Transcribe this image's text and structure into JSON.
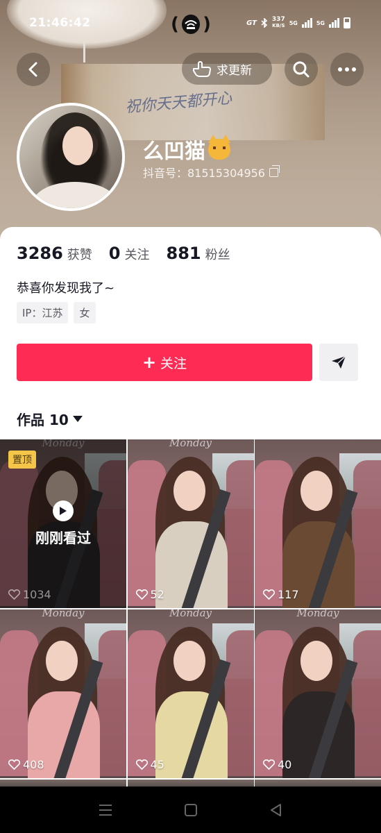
{
  "status_bar": {
    "time": "21:46:42",
    "network_speed_value": "337",
    "network_speed_unit": "KB/S",
    "network_label_1": "5G",
    "network_label_2": "5G",
    "carrier_badge": "GT"
  },
  "header": {
    "update_label": "求更新",
    "cover_text": "祝你天天都开心"
  },
  "profile": {
    "name": "么凹猫",
    "douyin_id": "抖音号：81515304956"
  },
  "stats": [
    {
      "num": "3286",
      "label": "获赞"
    },
    {
      "num": "0",
      "label": "关注"
    },
    {
      "num": "881",
      "label": "粉丝"
    }
  ],
  "bio": "恭喜你发现我了~",
  "tags": [
    "IP：江苏",
    "女"
  ],
  "actions": {
    "follow_label": "关注",
    "follow_plus": "+"
  },
  "works_tab": "作品 10",
  "videos": [
    {
      "likes": "1034",
      "watermark": "Monday",
      "pinned": "置顶",
      "watched": "刚刚看过",
      "outfit": "#2f2a2a"
    },
    {
      "likes": "52",
      "watermark": "Monday",
      "outfit": "#d9cfc0"
    },
    {
      "likes": "117",
      "watermark": "",
      "outfit": "#6a4a32"
    },
    {
      "likes": "408",
      "watermark": "Monday",
      "outfit": "#e8a8a8"
    },
    {
      "likes": "45",
      "watermark": "Monday",
      "outfit": "#e6d8a2"
    },
    {
      "likes": "40",
      "watermark": "Monday",
      "outfit": "#2c2626"
    }
  ],
  "colors": {
    "accent": "#fe2c55",
    "pinned_badge": "#f5c54a"
  },
  "icons": [
    "back-icon",
    "hand-pointer-icon",
    "search-icon",
    "more-icon",
    "copy-icon",
    "send-icon",
    "heart-icon",
    "play-icon",
    "menu-icon",
    "home-icon",
    "nav-back-icon"
  ]
}
